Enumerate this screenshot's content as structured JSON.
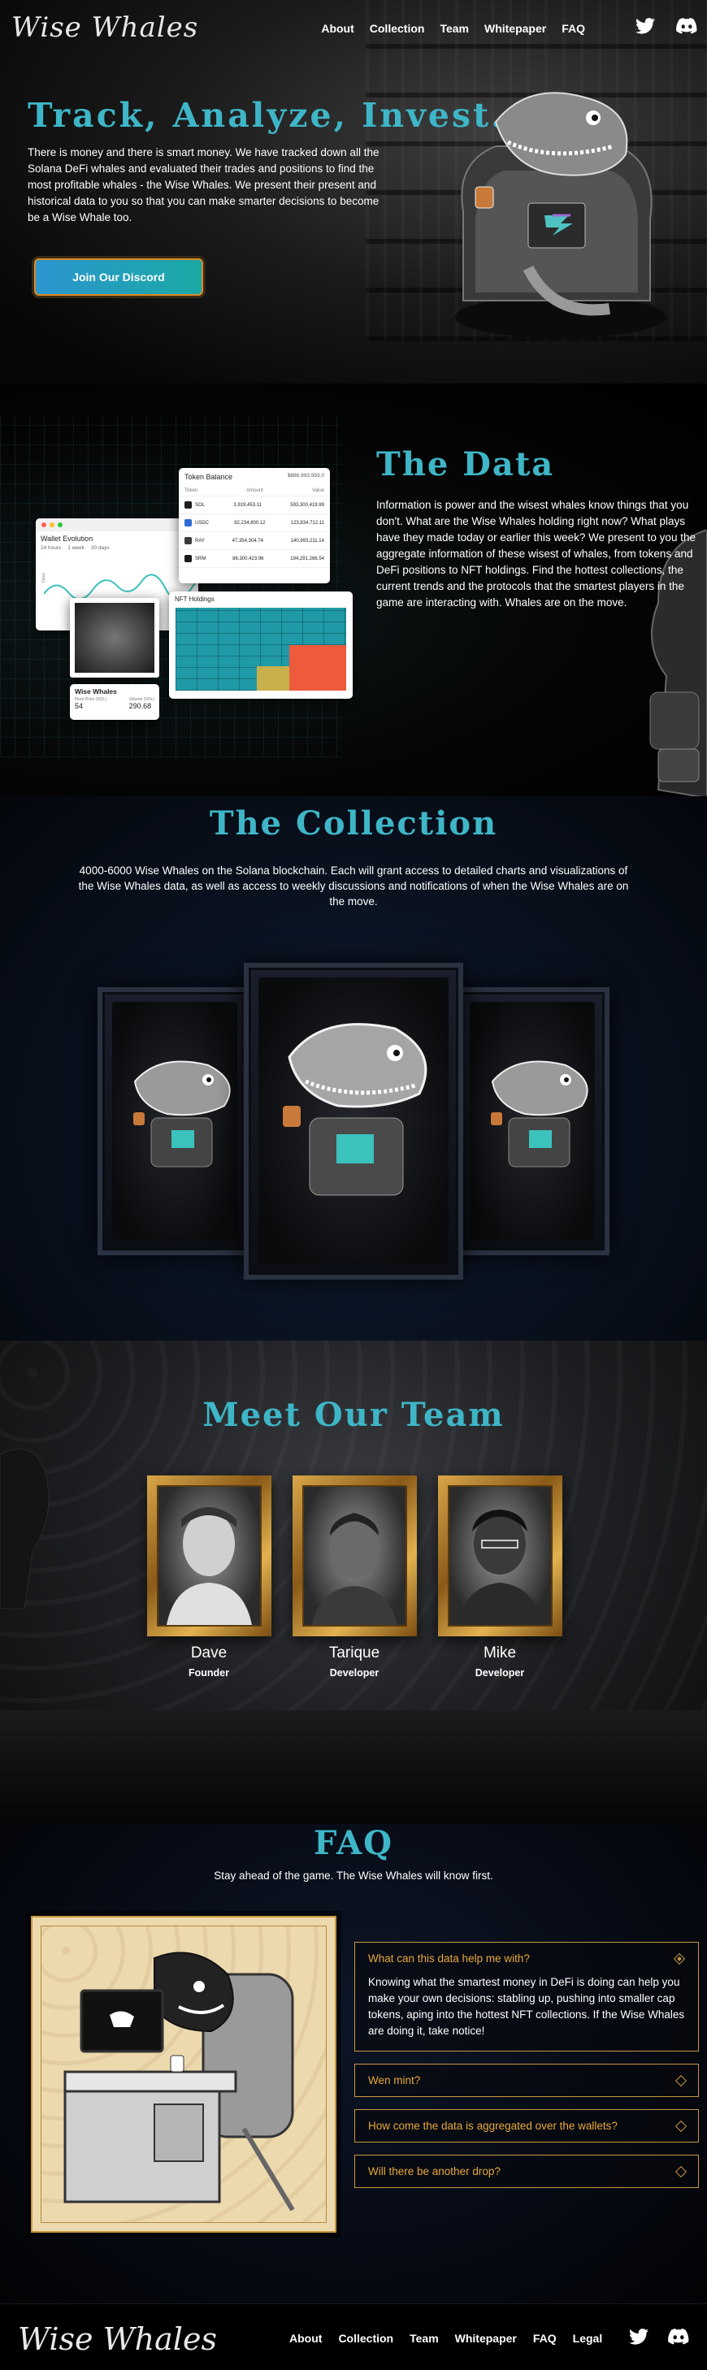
{
  "brand": {
    "logo_text": "Wise Whales"
  },
  "nav": {
    "links": [
      "About",
      "Collection",
      "Team",
      "Whitepaper",
      "FAQ"
    ],
    "icons": [
      "twitter-icon",
      "discord-icon"
    ]
  },
  "hero": {
    "title": "Track, Analyze, Invest.",
    "text": "There is money and there is smart money. We have tracked down all the Solana DeFi whales and evaluated their trades and positions to find the most profitable whales - the Wise Whales. We present their present and historical data to you so that you can make smarter decisions to become be a Wise Whale too.",
    "cta": "Join Our Discord"
  },
  "data_section": {
    "title": "The Data",
    "text": "Information is power and the wisest whales know things that you don't. What are the Wise Whales holding right now? What plays have they made today or earlier this week? We present to you the aggregate information of these wisest of whales, from tokens and DeFi positions to NFT holdings. Find the hottest collections, the current trends and the protocols that the smartest players in the game are interacting with. Whales are on the move.",
    "token_card": {
      "title": "Token Balance",
      "total": "$886,993,993.0",
      "headers": [
        "Token",
        "Amount",
        "Value"
      ],
      "rows": [
        {
          "token": "SOL",
          "amount": "3,919,453.11",
          "value": "593,300,419.99"
        },
        {
          "token": "USDC",
          "amount": "82,234,800.12",
          "value": "123,834,712.11"
        },
        {
          "token": "RAY",
          "amount": "47,354,304.74",
          "value": "140,993,211.14"
        },
        {
          "token": "SRM",
          "amount": "86,300,423.96",
          "value": "194,291,266.54"
        }
      ]
    },
    "wallet_card": {
      "title": "Wallet Evolution",
      "filters": [
        "24 hours",
        "1 week",
        "30 days"
      ],
      "ylabel": "Value"
    },
    "nft_card": {
      "title": "NFT Holdings"
    },
    "whale_card": {
      "title": "Wise Whales",
      "stats": [
        {
          "label": "Floor Price (SOL)",
          "value": "54"
        },
        {
          "label": "Volume (SOL)",
          "value": "290.68"
        }
      ]
    }
  },
  "collection": {
    "title": "The Collection",
    "text": "4000-6000 Wise Whales on the Solana blockchain. Each will grant access to detailed charts and visualizations of the Wise Whales data, as well as access to weekly discussions and notifications of when the Wise Whales are on the move."
  },
  "team": {
    "title": "Meet Our Team",
    "members": [
      {
        "name": "Dave",
        "role": "Founder"
      },
      {
        "name": "Tarique",
        "role": "Developer"
      },
      {
        "name": "Mike",
        "role": "Developer"
      }
    ]
  },
  "faq": {
    "title": "FAQ",
    "subtitle": "Stay ahead of the game. The Wise Whales will know first.",
    "items": [
      {
        "q": "What can this data help me with?",
        "a": "Knowing what the smartest money in DeFi is doing can help you make your own decisions: stabling up, pushing into smaller cap tokens, aping into the hottest NFT collections. If the Wise Whales are doing it, take notice!"
      },
      {
        "q": "Wen mint?"
      },
      {
        "q": "How come the data is aggregated over the wallets?"
      },
      {
        "q": "Will there be another drop?"
      }
    ]
  },
  "footer": {
    "logo_text": "Wise Whales",
    "links": [
      "About",
      "Collection",
      "Team",
      "Whitepaper",
      "FAQ",
      "Legal"
    ]
  },
  "colors": {
    "accent_teal": "#3eb6c7",
    "faq_gold": "#e8a93a",
    "frame_gold": "#c8973e"
  }
}
